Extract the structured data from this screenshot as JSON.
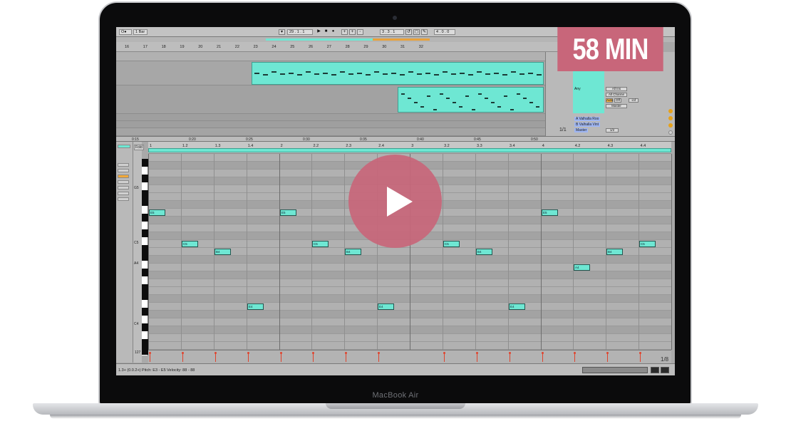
{
  "overlay": {
    "duration_badge": "58 MIN",
    "play_button": "play-icon",
    "accent_color": "#c8667a"
  },
  "device": {
    "brand_label": "MacBook Air"
  },
  "toolbar": {
    "quantize": "1 Bar",
    "bpm_position": "29 . 1 . 1",
    "loop_start": "3 . 3 . 1",
    "loop_length": "4 . 0 . 0",
    "mode_label": "O●"
  },
  "arrangement": {
    "ruler_marks": [
      "16",
      "17",
      "18",
      "19",
      "20",
      "21",
      "22",
      "23",
      "24",
      "25",
      "26",
      "27",
      "28",
      "29",
      "30",
      "31",
      "32"
    ],
    "time_marks": [
      "0:15",
      "0:20",
      "0:25",
      "0:30",
      "0:35",
      "0:40",
      "0:45",
      "0:50"
    ],
    "page_counter": "1/1"
  },
  "mixer": {
    "input_any": "Any",
    "routing_master": "Master",
    "all_ins": "All Ins",
    "all_channels": "All Channe",
    "track_a": "A Valhalla Roo",
    "track_b": "B Valhalla Vint",
    "master": "Master",
    "master_fraction": "1/2",
    "auto_label": "Auto",
    "off_label": "Off",
    "inf_label": "-inf"
  },
  "clip_view": {
    "fold_label": "Fold",
    "ruler_marks": [
      "1",
      "1.2",
      "1.3",
      "1.4",
      "2",
      "2.2",
      "2.3",
      "2.4",
      "3",
      "3.2",
      "3.3",
      "3.4",
      "4",
      "4.2",
      "4.3",
      "4.4"
    ],
    "key_labels": [
      "G5",
      "C5",
      "A4",
      "C4"
    ],
    "notes": [
      {
        "label": "E5"
      },
      {
        "label": "C5"
      },
      {
        "label": "B4"
      },
      {
        "label": "E4"
      },
      {
        "label": "E5"
      },
      {
        "label": "C5"
      },
      {
        "label": "B4"
      },
      {
        "label": "E4"
      },
      {
        "label": "C5"
      },
      {
        "label": "B4"
      },
      {
        "label": "E4"
      },
      {
        "label": "E5"
      },
      {
        "label": "A4"
      },
      {
        "label": "B4"
      },
      {
        "label": "C5"
      }
    ],
    "velocity_max": "127",
    "velocity_min": "0",
    "page_fraction": "1/8"
  },
  "status": {
    "text": "1.3+ (0.0.2+)    Pitch: E3 - E5    Velocity: 88 - 88"
  }
}
